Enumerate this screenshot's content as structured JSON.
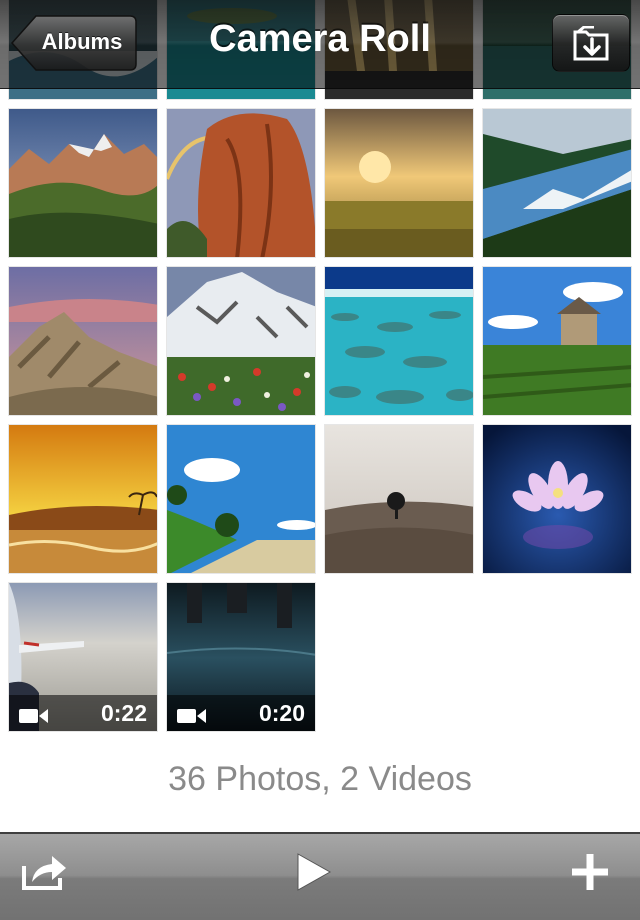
{
  "nav": {
    "title": "Camera Roll",
    "back_label": "Albums",
    "action_icon": "folder-arrow-icon"
  },
  "photos": [
    {
      "kind": "photo",
      "scene": "mountain-valley"
    },
    {
      "kind": "photo",
      "scene": "red-rock-rainbow"
    },
    {
      "kind": "photo",
      "scene": "golden-meadow"
    },
    {
      "kind": "photo",
      "scene": "mountain-lake"
    },
    {
      "kind": "photo",
      "scene": "desert-ridges"
    },
    {
      "kind": "photo",
      "scene": "wildflower-mountain"
    },
    {
      "kind": "photo",
      "scene": "coral-reef"
    },
    {
      "kind": "photo",
      "scene": "farm-house-field"
    },
    {
      "kind": "photo",
      "scene": "tropical-sunset"
    },
    {
      "kind": "photo",
      "scene": "country-road"
    },
    {
      "kind": "photo",
      "scene": "lone-tree"
    },
    {
      "kind": "photo",
      "scene": "lotus-flower"
    },
    {
      "kind": "video",
      "scene": "airplane-wing",
      "duration": "0:22"
    },
    {
      "kind": "video",
      "scene": "water-reflection",
      "duration": "0:20"
    }
  ],
  "summary": "36 Photos, 2 Videos",
  "toolbar": {
    "share_icon": "share-icon",
    "play_icon": "play-icon",
    "add_icon": "plus-icon"
  },
  "colors": {
    "summary_text": "#8a8a8a",
    "toolbar_top": "#a7a7a7",
    "toolbar_bottom": "#727272"
  }
}
